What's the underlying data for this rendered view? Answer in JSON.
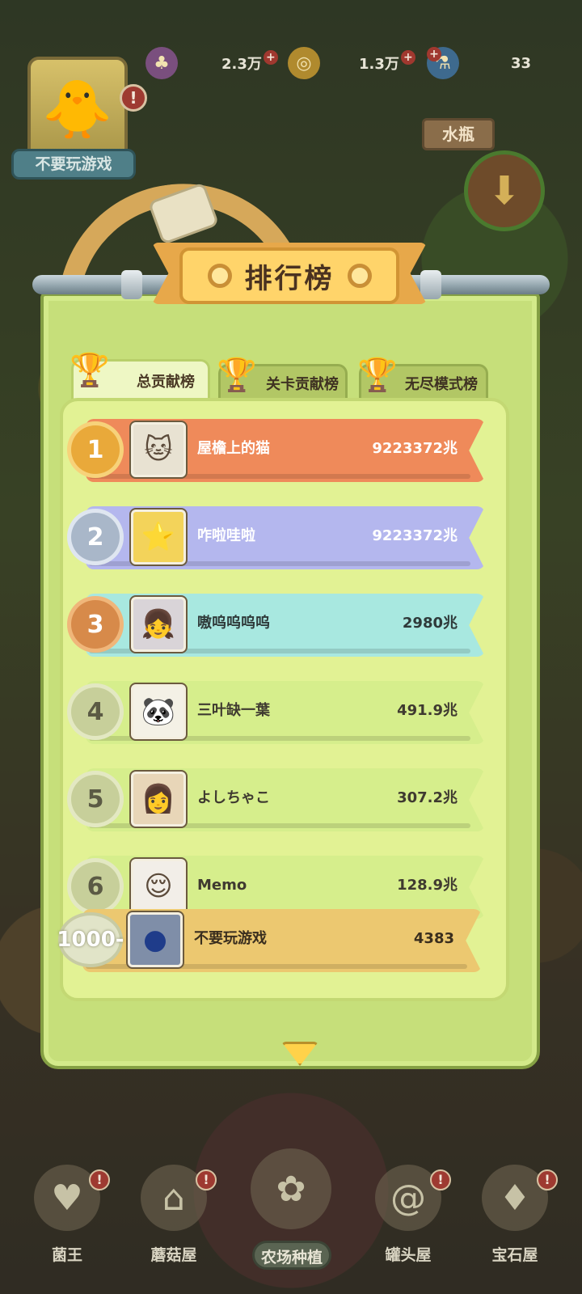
{
  "hud": {
    "player_name": "不要玩游戏",
    "alert_mark": "!",
    "resources": [
      {
        "icon": "mushroom-icon",
        "value": "2.3万",
        "plus": "+"
      },
      {
        "icon": "coin-icon",
        "value": "1.3万",
        "plus": "+"
      },
      {
        "icon": "potion-icon",
        "value": "33",
        "plus": "+"
      }
    ],
    "side_sign": "水瓶"
  },
  "panel": {
    "title": "排行榜",
    "tabs": [
      {
        "label": "总贡献榜",
        "active": true
      },
      {
        "label": "关卡贡献榜",
        "active": false
      },
      {
        "label": "无尽模式榜",
        "active": false
      }
    ],
    "rows": [
      {
        "rank": "1",
        "name": "屋檐上的猫",
        "score": "9223372兆",
        "color": "#ef8a5a",
        "badge": "#e9a93a"
      },
      {
        "rank": "2",
        "name": "咋啦哇啦",
        "score": "9223372兆",
        "color": "#b4b7ee",
        "badge": "#a9b7c9"
      },
      {
        "rank": "3",
        "name": "嗷呜呜呜呜",
        "score": "2980兆",
        "color": "#a8e8e0",
        "badge": "#d78a4a"
      },
      {
        "rank": "4",
        "name": "三叶缺一葉",
        "score": "491.9兆",
        "color": "#d6ee8c",
        "badge": "#c7cf9a"
      },
      {
        "rank": "5",
        "name": "よしちゃこ",
        "score": "307.2兆",
        "color": "#d6ee8c",
        "badge": "#c7cf9a"
      },
      {
        "rank": "6",
        "name": "Memo",
        "score": "128.9兆",
        "color": "#d6ee8c",
        "badge": "#c7cf9a"
      }
    ],
    "self": {
      "rank": "1000-",
      "name": "不要玩游戏",
      "score": "4383",
      "color": "#ecc870"
    }
  },
  "nav": {
    "items": [
      {
        "label": "菌王",
        "icon": "heart-jar-icon"
      },
      {
        "label": "蘑菇屋",
        "icon": "mushroom-house-icon"
      },
      {
        "label": "农场种植",
        "icon": "watering-can-icon"
      },
      {
        "label": "罐头屋",
        "icon": "swirl-jar-icon"
      },
      {
        "label": "宝石屋",
        "icon": "gem-shop-icon"
      }
    ],
    "badge": "!"
  }
}
